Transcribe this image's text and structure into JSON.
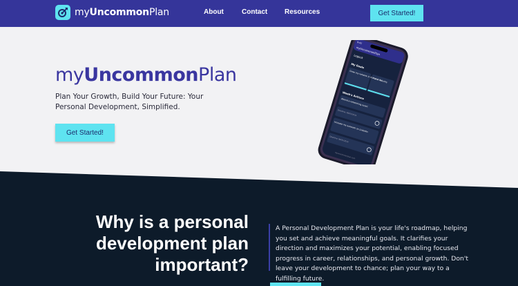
{
  "colors": {
    "nav_bg": "#35359a",
    "accent": "#5ee3f0",
    "brand": "#3a36a0",
    "dark_band": "#0d1b2a"
  },
  "header": {
    "logo_icon": "target-icon",
    "logo_prefix": "my",
    "logo_bold": "Uncommon",
    "logo_suffix": "Plan",
    "nav": [
      "About",
      "Contact",
      "Resources"
    ],
    "cta_label": "Get Started!"
  },
  "hero": {
    "brand_prefix": "my",
    "brand_bold": "Uncommon",
    "brand_suffix": "Plan",
    "tagline": "Plan Your Growth, Build Your Future: Your Personal Development, Simplified.",
    "cta_label": "Get Started!"
  },
  "phone": {
    "status_time": "9:41",
    "app_title": "myUncommonPlan",
    "logout": "Logout",
    "goals_label": "My Goals",
    "goal_1": "Grow my network in the tech industry",
    "goal_2": "Run a 5k",
    "actions_label": "Week's Actions",
    "action_1": "Attend a networking event",
    "action_1_date": "Deadline: 06/01/2024",
    "action_2": "Increase my outreach on LinkedIn",
    "action_2_date": "Deadline: 06/01/2024",
    "footer": "myuncommonplan.com"
  },
  "why": {
    "heading": "Why is a personal development plan important?",
    "body": "A Personal Development Plan is your life's roadmap, helping you set and achieve meaningful goals. It clarifies your direction and maximizes your potential, enabling focused progress in career, relationships, and personal growth. Don't leave your development to chance; plan your way to a fulfilling future."
  }
}
